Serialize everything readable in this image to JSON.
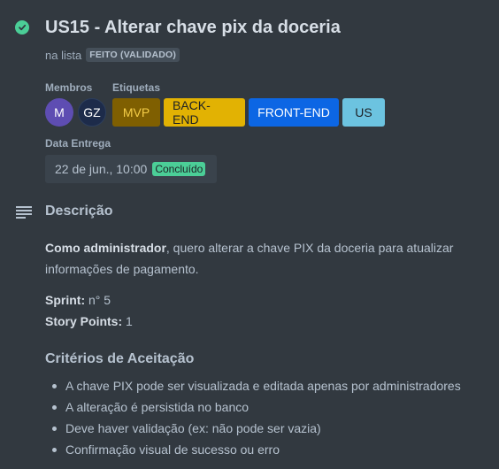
{
  "card": {
    "title": "US15 - Alterar chave pix da doceria",
    "list_prefix": "na lista",
    "list_name": "FEITO (VALIDADO)"
  },
  "members": {
    "label": "Membros",
    "items": [
      {
        "initials": "M",
        "color": "#5e4db2"
      },
      {
        "initials": "GZ",
        "color": "#1d2b4a"
      }
    ]
  },
  "labels": {
    "label": "Etiquetas",
    "items": [
      {
        "text": "MVP",
        "bg": "#7f5f01",
        "fg": "#f5cd47"
      },
      {
        "text": "BACK-END",
        "bg": "#e2b203",
        "fg": "#1d2125"
      },
      {
        "text": "FRONT-END",
        "bg": "#0c66e4",
        "fg": "#ffffff"
      },
      {
        "text": "US",
        "bg": "#6cc3e0",
        "fg": "#1d2125"
      }
    ]
  },
  "due": {
    "label": "Data Entrega",
    "value": "22 de jun., 10:00",
    "status": "Concluído"
  },
  "description": {
    "heading": "Descrição",
    "intro_bold": "Como administrador",
    "intro_rest": ", quero alterar a chave PIX da doceria para atualizar informações de pagamento.",
    "sprint_label": "Sprint:",
    "sprint_value": "n° 5",
    "points_label": "Story Points:",
    "points_value": "1"
  },
  "criteria": {
    "heading": "Critérios de Aceitação",
    "items": [
      "A chave PIX pode ser visualizada e editada apenas por administradores",
      "A alteração é persistida no banco",
      "Deve haver validação (ex: não pode ser vazia)",
      "Confirmação visual de sucesso ou erro"
    ]
  },
  "icons": {
    "status": "check-circle-icon",
    "description": "description-lines-icon"
  },
  "colors": {
    "background": "#323940",
    "done": "#4bce97"
  }
}
